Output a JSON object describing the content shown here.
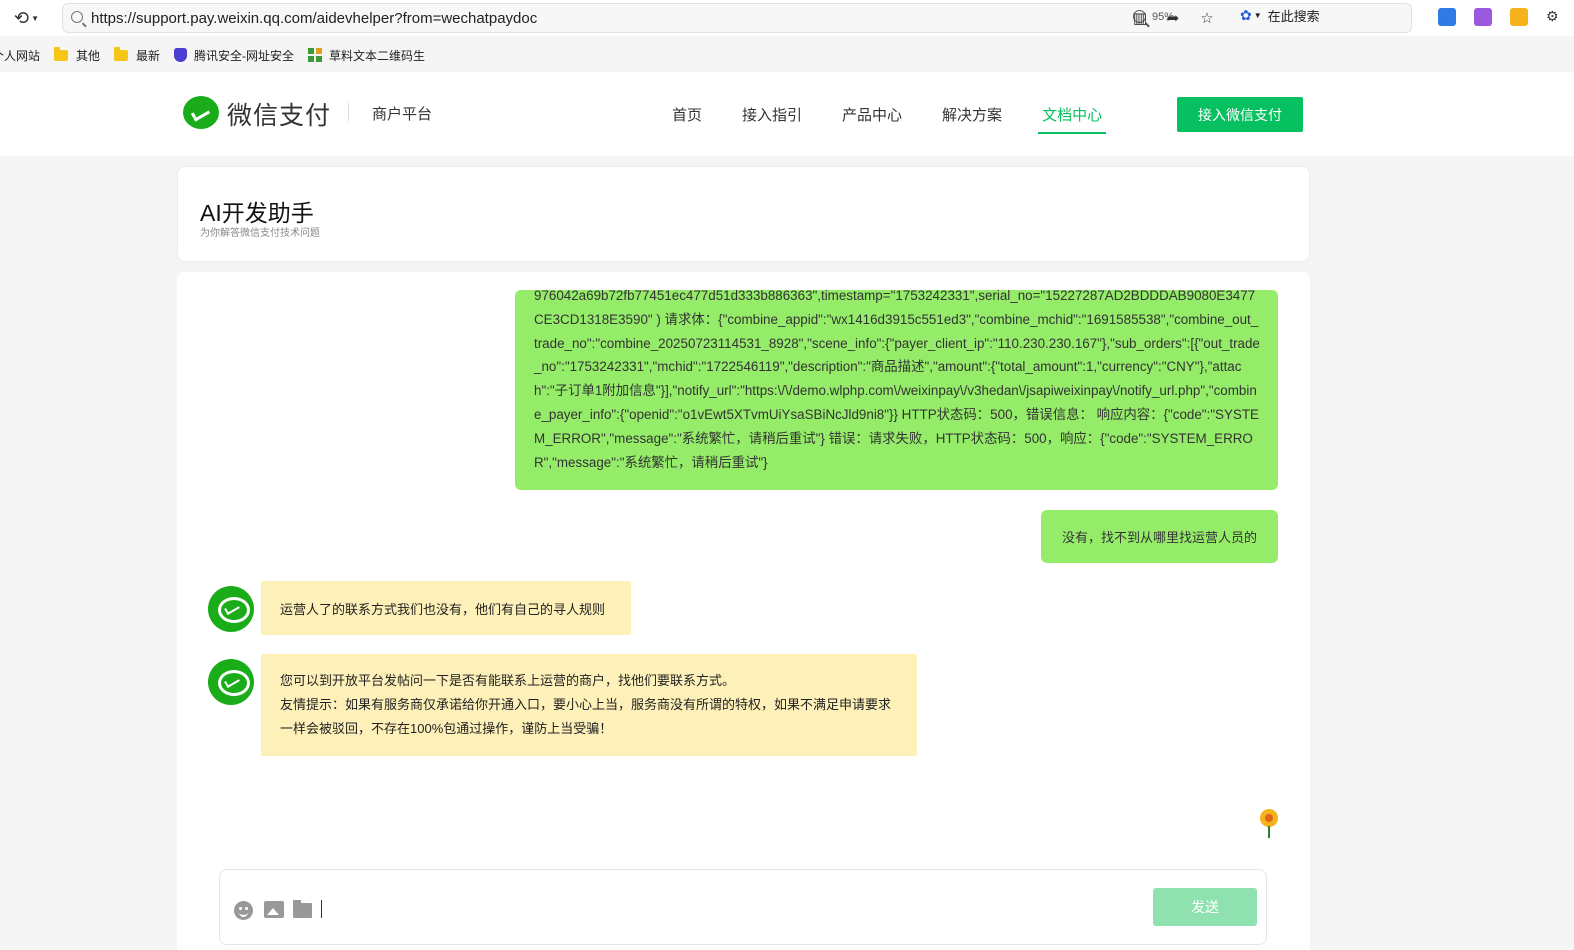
{
  "browser": {
    "url": "https://support.pay.weixin.qq.com/aidevhelper?from=wechatpaydoc",
    "zoom": "95%",
    "search_label": "在此搜索"
  },
  "bookmarks": [
    {
      "label": "个人网站",
      "icon": "none"
    },
    {
      "label": "其他",
      "icon": "folder-icon"
    },
    {
      "label": "最新",
      "icon": "folder-icon"
    },
    {
      "label": "腾讯安全-网址安全",
      "icon": "shield-icon"
    },
    {
      "label": "草料文本二维码生",
      "icon": "qr-icon"
    }
  ],
  "header": {
    "logo_text": "微信支付",
    "platform": "商户平台",
    "nav": [
      {
        "label": "首页",
        "active": false
      },
      {
        "label": "接入指引",
        "active": false
      },
      {
        "label": "产品中心",
        "active": false
      },
      {
        "label": "解决方案",
        "active": false
      },
      {
        "label": "文档中心",
        "active": true
      }
    ],
    "join_button": "接入微信支付",
    "accent": "#07c160"
  },
  "page": {
    "title": "AI开发助手",
    "subtitle": "为你解答微信支付技术问题"
  },
  "messages": [
    {
      "role": "user",
      "text": "976042a69b72fb77451ec477d51d333b886363\",timestamp=\"1753242331\",serial_no=\"15227287AD2BDDDAB9080E3477CE3CD1318E3590\" ) 请求体：{\"combine_appid\":\"wx1416d3915c551ed3\",\"combine_mchid\":\"1691585538\",\"combine_out_trade_no\":\"combine_20250723114531_8928\",\"scene_info\":{\"payer_client_ip\":\"110.230.230.167\"},\"sub_orders\":[{\"out_trade_no\":\"1753242331\",\"mchid\":\"1722546119\",\"description\":\"商品描述\",\"amount\":{\"total_amount\":1,\"currency\":\"CNY\"},\"attach\":\"子订单1附加信息\"}],\"notify_url\":\"https:\\/\\/demo.wlphp.com\\/weixinpay\\/v3hedan\\/jsapiweixinpay\\/notify_url.php\",\"combine_payer_info\":{\"openid\":\"o1vEwt5XTvmUiYsaSBiNcJld9ni8\"}} HTTP状态码：500，错误信息： 响应内容：{\"code\":\"SYSTEM_ERROR\",\"message\":\"系统繁忙，请稍后重试\"} 错误：请求失败，HTTP状态码：500，响应：{\"code\":\"SYSTEM_ERROR\",\"message\":\"系统繁忙，请稍后重试\"}"
    },
    {
      "role": "user",
      "text": "没有，找不到从哪里找运营人员的"
    },
    {
      "role": "bot",
      "text": "运营人了的联系方式我们也没有，他们有自己的寻人规则"
    },
    {
      "role": "bot",
      "lines": [
        "您可以到开放平台发帖问一下是否有能联系上运营的商户，找他们要联系方式。",
        "友情提示：如果有服务商仅承诺给你开通入口，要小心上当，服务商没有所谓的特权，如果不满足申请要求一样会被驳回，不存在100%包通过操作，谨防上当受骗！"
      ]
    }
  ],
  "composer": {
    "input_value": "",
    "send_label": "发送"
  }
}
